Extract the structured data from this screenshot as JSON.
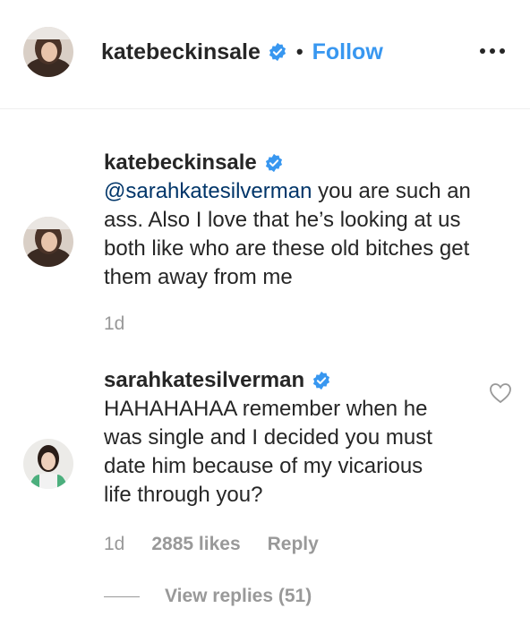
{
  "post_header": {
    "username": "katebeckinsale",
    "separator": "•",
    "follow_label": "Follow",
    "more_icon": "more-options-icon",
    "verified_icon": "verified-badge-icon"
  },
  "comments": [
    {
      "username": "katebeckinsale",
      "mention": "@sarahkatesilverman",
      "lines": [
        " you are such an",
        "ass. Also I love that he’s looking at us",
        "both like who are these old bitches get",
        "them away from me"
      ],
      "time": "1d"
    },
    {
      "username": "sarahkatesilverman",
      "lines": [
        "HAHAHAHAA remember when he",
        "was single and I decided you must",
        "date him because of my vicarious",
        "life through you?"
      ],
      "time": "1d",
      "likes": "2885 likes",
      "reply_label": "Reply",
      "like_icon": "heart-icon"
    }
  ],
  "view_replies_label": "View replies (51)",
  "colors": {
    "link_blue": "#3897f0",
    "mention": "#003569",
    "text": "#262626",
    "muted": "#999999"
  }
}
